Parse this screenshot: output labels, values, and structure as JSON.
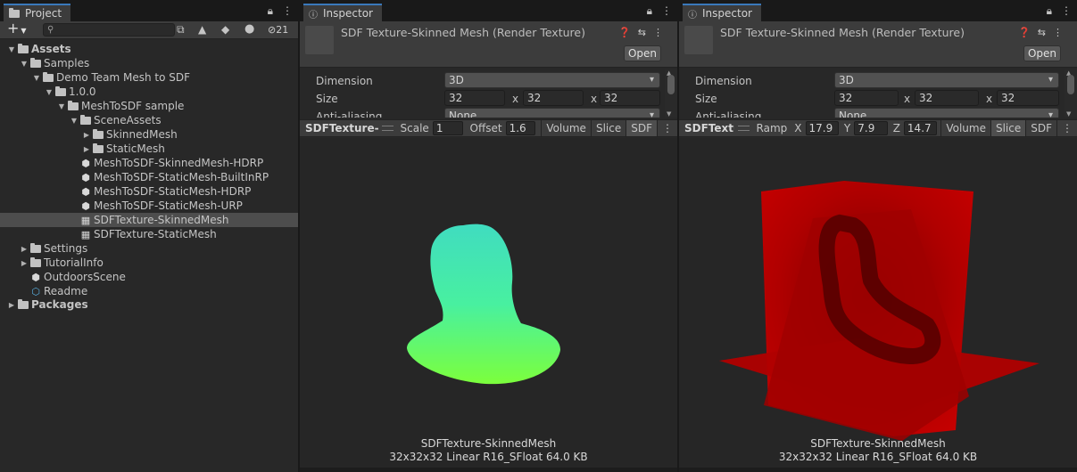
{
  "project": {
    "tab_label": "Project",
    "toolbar": {
      "add_label": "+",
      "search_placeholder": "",
      "hidden_count": "21"
    },
    "tree": [
      {
        "label": "Assets",
        "bold": true,
        "arrow": "▼",
        "icon": "folder"
      },
      {
        "label": "Samples",
        "arrow": "▼",
        "icon": "folder"
      },
      {
        "label": "Demo Team Mesh to SDF",
        "arrow": "▼",
        "icon": "folder"
      },
      {
        "label": "1.0.0",
        "arrow": "▼",
        "icon": "folder"
      },
      {
        "label": "MeshToSDF sample",
        "arrow": "▼",
        "icon": "folder"
      },
      {
        "label": "SceneAssets",
        "arrow": "▼",
        "icon": "folder"
      },
      {
        "label": "SkinnedMesh",
        "arrow": "▶",
        "icon": "folder"
      },
      {
        "label": "StaticMesh",
        "arrow": "▶",
        "icon": "folder"
      },
      {
        "label": "MeshToSDF-SkinnedMesh-HDRP",
        "arrow": "",
        "icon": "unity-scene"
      },
      {
        "label": "MeshToSDF-StaticMesh-BuiltInRP",
        "arrow": "",
        "icon": "unity-scene"
      },
      {
        "label": "MeshToSDF-StaticMesh-HDRP",
        "arrow": "",
        "icon": "unity-scene"
      },
      {
        "label": "MeshToSDF-StaticMesh-URP",
        "arrow": "",
        "icon": "unity-scene"
      },
      {
        "label": "SDFTexture-SkinnedMesh",
        "arrow": "",
        "icon": "render-texture",
        "selected": true
      },
      {
        "label": "SDFTexture-StaticMesh",
        "arrow": "",
        "icon": "render-texture"
      },
      {
        "label": "Settings",
        "arrow": "▶",
        "icon": "folder"
      },
      {
        "label": "TutorialInfo",
        "arrow": "▶",
        "icon": "folder"
      },
      {
        "label": "OutdoorsScene",
        "arrow": "",
        "icon": "unity-scene"
      },
      {
        "label": "Readme",
        "arrow": "",
        "icon": "readme"
      },
      {
        "label": "Packages",
        "bold": true,
        "arrow": "▶",
        "icon": "folder"
      }
    ]
  },
  "inspector_left": {
    "tab_label": "Inspector",
    "title": "SDF Texture-Skinned Mesh (Render Texture)",
    "open_label": "Open",
    "dimension_label": "Dimension",
    "dimension_value": "3D",
    "size_label": "Size",
    "size_x": "32",
    "size_y": "32",
    "size_z": "32",
    "x_sep": "x",
    "aa_label": "Anti-aliasing",
    "aa_value": "None",
    "preview_toolbar": {
      "name": "SDFTexture-SkinnedMesh",
      "scale_label": "Scale",
      "scale_value": "1",
      "offset_label": "Offset",
      "offset_value": "1.6",
      "volume_label": "Volume",
      "slice_label": "Slice",
      "sdf_label": "SDF",
      "active": "SDF"
    },
    "caption_name": "SDFTexture-SkinnedMesh",
    "caption_info": "32x32x32 Linear  R16_SFloat  64.0 KB"
  },
  "inspector_right": {
    "tab_label": "Inspector",
    "title": "SDF Texture-Skinned Mesh (Render Texture)",
    "open_label": "Open",
    "dimension_label": "Dimension",
    "dimension_value": "3D",
    "size_label": "Size",
    "size_x": "32",
    "size_y": "32",
    "size_z": "32",
    "x_sep": "x",
    "aa_label": "Anti-aliasing",
    "aa_value": "None",
    "preview_toolbar": {
      "name": "SDFTexture-SkinnedMesh",
      "ramp_label": "Ramp",
      "x_label": "X",
      "x_value": "17.9",
      "y_label": "Y",
      "y_value": "7.9",
      "z_label": "Z",
      "z_value": "14.7",
      "volume_label": "Volume",
      "slice_label": "Slice",
      "sdf_label": "SDF",
      "active": "Slice"
    },
    "caption_name": "SDFTexture-SkinnedMesh",
    "caption_info": "32x32x32 Linear  R16_SFloat  64.0 KB"
  },
  "colors": {
    "accent_tab": "#3a79bb",
    "head_gradient_top": "#3fe3b8",
    "head_gradient_bottom": "#77ff3a",
    "slice_red": "#c40000"
  }
}
